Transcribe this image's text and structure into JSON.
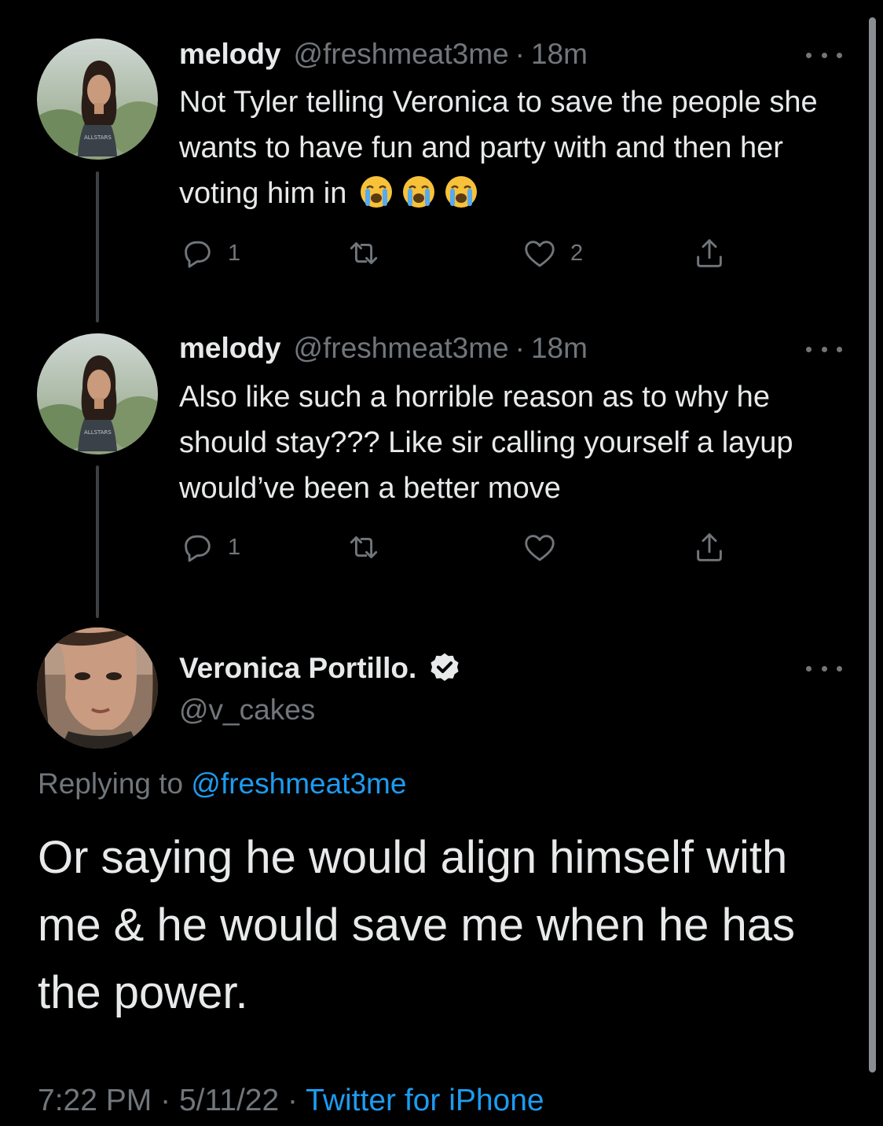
{
  "thread": [
    {
      "display_name": "melody",
      "handle": "@freshmeat3me",
      "separator": "·",
      "time": "18m",
      "text": "Not Tyler telling Veronica to save the people she wants to have fun and party with and then her voting him in",
      "emojis": [
        "loudly-crying-face",
        "loudly-crying-face",
        "loudly-crying-face"
      ],
      "reply_count": "1",
      "retweet_count": "",
      "like_count": "2",
      "icons": {
        "reply": "reply-icon",
        "retweet": "retweet-icon",
        "like": "heart-icon",
        "share": "share-icon",
        "more": "more-icon"
      }
    },
    {
      "display_name": "melody",
      "handle": "@freshmeat3me",
      "separator": "·",
      "time": "18m",
      "text": "Also like such a horrible reason as to why he should stay??? Like sir calling yourself a layup would’ve been a better move",
      "reply_count": "1",
      "retweet_count": "",
      "like_count": "",
      "icons": {
        "reply": "reply-icon",
        "retweet": "retweet-icon",
        "like": "heart-icon",
        "share": "share-icon",
        "more": "more-icon"
      }
    }
  ],
  "main_tweet": {
    "display_name": "Veronica Portillo.",
    "handle": "@v_cakes",
    "verified": true,
    "replying_prefix": "Replying to",
    "replying_to": "@freshmeat3me",
    "text": "Or saying he would align himself with me & he would save me when he has the power.",
    "time": "7:22 PM",
    "date": "5/11/22",
    "separator": "·",
    "source": "Twitter for iPhone"
  },
  "colors": {
    "background": "#000000",
    "text": "#e7e9ea",
    "secondary": "#71767b",
    "accent": "#1d9bf0",
    "thread_line": "#3e4144"
  }
}
